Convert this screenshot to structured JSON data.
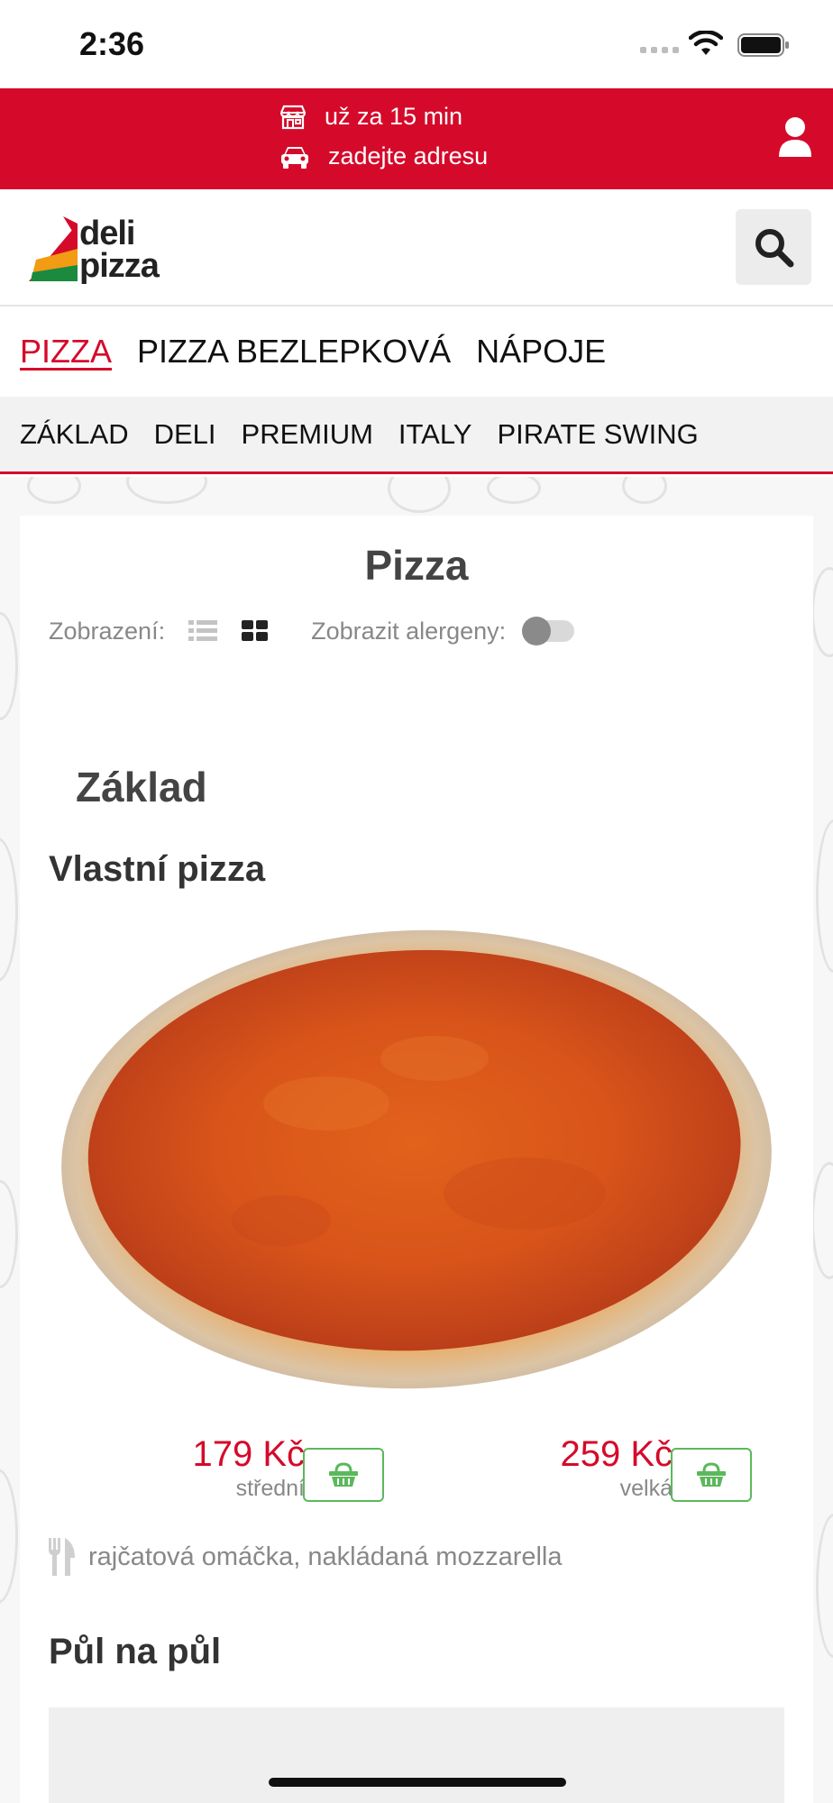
{
  "status_bar": {
    "time": "2:36"
  },
  "banner": {
    "delivery_time": "už za 15 min",
    "address": "zadejte adresu"
  },
  "logo": {
    "line1": "deli",
    "line2": "pizza"
  },
  "main_nav": [
    {
      "label": "PIZZA",
      "active": true
    },
    {
      "label": "PIZZA BEZLEPKOVÁ",
      "active": false
    },
    {
      "label": "NÁPOJE",
      "active": false
    }
  ],
  "sub_nav": [
    "ZÁKLAD",
    "DELI",
    "PREMIUM",
    "ITALY",
    "PIRATE SWING"
  ],
  "page": {
    "title": "Pizza",
    "view_label": "Zobrazení:",
    "allergen_label": "Zobrazit alergeny:"
  },
  "category": {
    "title": "Základ"
  },
  "product": {
    "name": "Vlastní pizza",
    "prices": [
      {
        "price": "179 Kč",
        "size": "střední"
      },
      {
        "price": "259 Kč",
        "size": "velká"
      }
    ],
    "ingredients": "rajčatová omáčka, nakládaná mozzarella"
  },
  "product2": {
    "name": "Půl na půl"
  },
  "colors": {
    "brand_red": "#d50a2a",
    "basket_green": "#5cb85c",
    "muted_text": "#888888"
  }
}
